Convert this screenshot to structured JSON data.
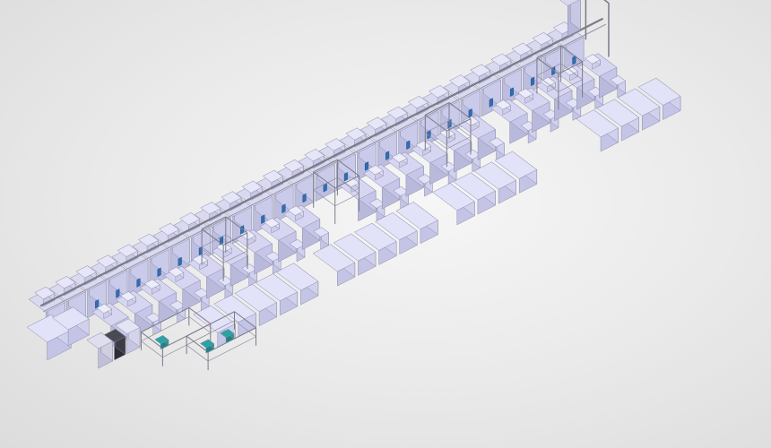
{
  "scene": {
    "description_visible_text": "",
    "colors": {
      "background": "#e9e9e9",
      "machine_top": "#d6d6f2",
      "machine_left": "#b9b9dc",
      "machine_right": "#c6c6e8",
      "cabinet_top": "#e2e2f8",
      "cabinet_left": "#c4c4e6",
      "cabinet_right": "#d1d1ee",
      "frame": "#7a7a8a",
      "accent_blue": "#2f6fb5",
      "accent_teal": "#2aa3a3",
      "dark_unit": "#2d2d33"
    }
  }
}
